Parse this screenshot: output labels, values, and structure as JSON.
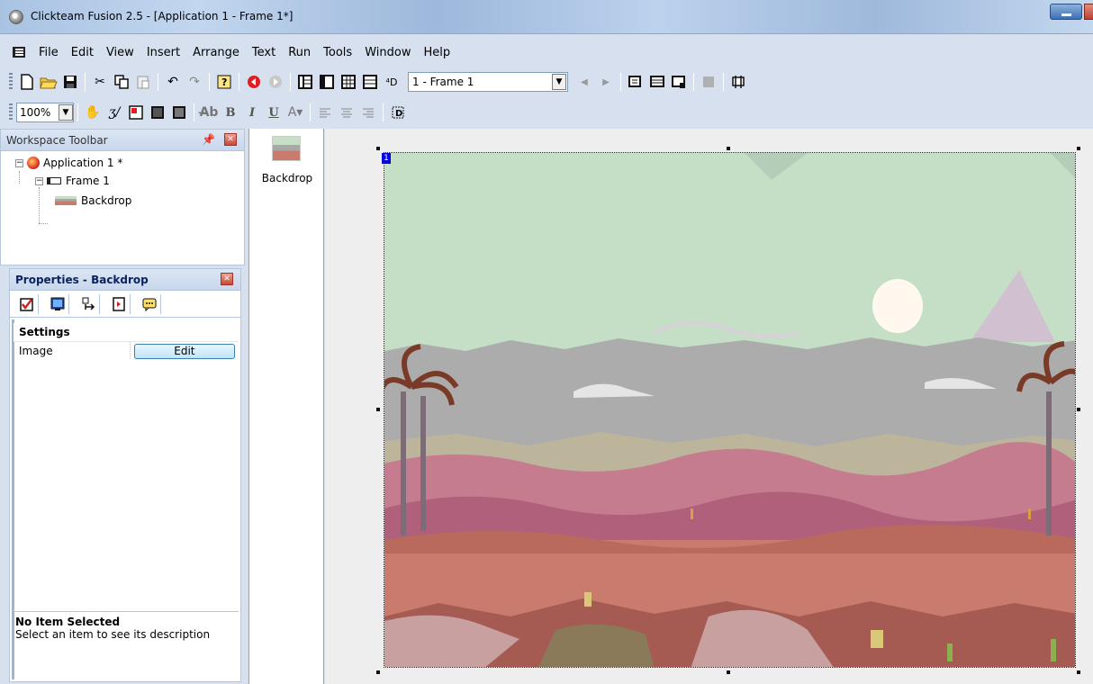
{
  "window": {
    "title": "Clickteam Fusion 2.5 - [Application 1 - Frame 1*]"
  },
  "menu": [
    "File",
    "Edit",
    "View",
    "Insert",
    "Arrange",
    "Text",
    "Run",
    "Tools",
    "Window",
    "Help"
  ],
  "toolbar": {
    "frame_select_value": "1 - Frame 1",
    "zoom_value": "100%",
    "bold_label": "B",
    "italic_label": "I",
    "underline_label": "U"
  },
  "workspace": {
    "title": "Workspace Toolbar",
    "tree": {
      "application": "Application 1 *",
      "frame": "Frame 1",
      "object": "Backdrop"
    }
  },
  "properties": {
    "title": "Properties - Backdrop",
    "section": "Settings",
    "rows": [
      {
        "label": "Image",
        "value": "Edit"
      }
    ],
    "description_title": "No Item Selected",
    "description_text": "Select an item to see its description"
  },
  "shelf": {
    "item_label": "Backdrop"
  },
  "editor": {
    "frame_number": "1"
  },
  "colors": {
    "sky": "#c4dfc6",
    "clouds": "#acacac",
    "sand": "#c97b6e",
    "dunes": "#b0607a",
    "sun": "#fff8ee"
  }
}
